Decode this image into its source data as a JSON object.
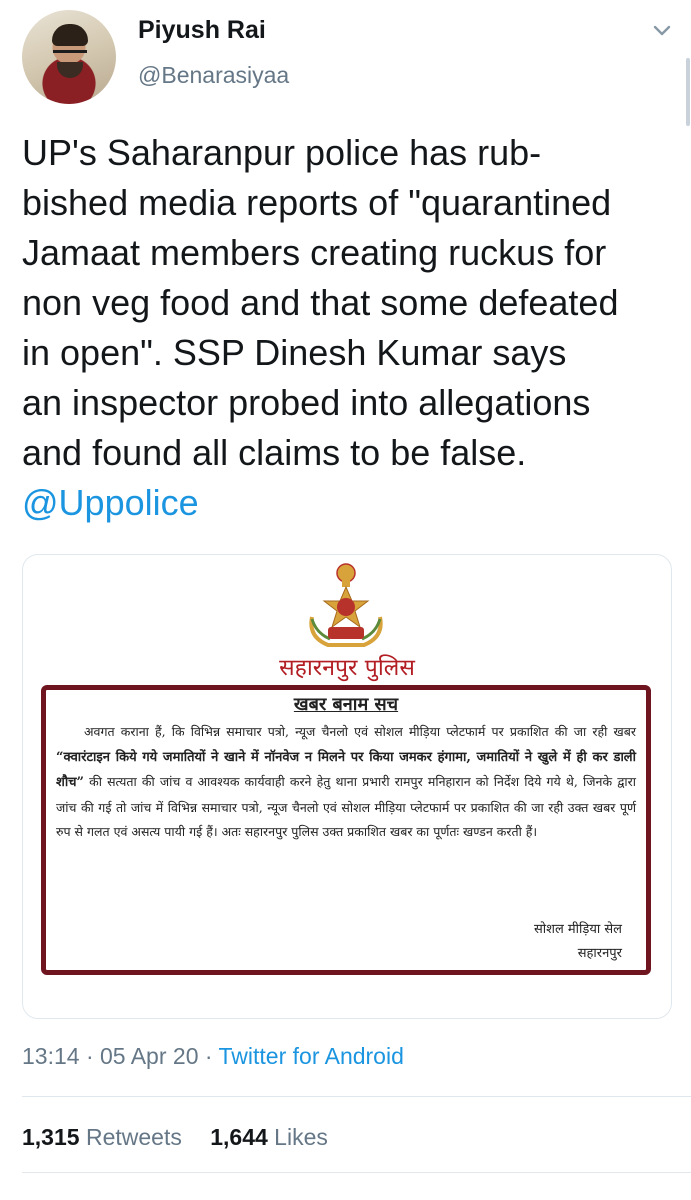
{
  "user": {
    "name": "Piyush Rai",
    "handle": "@Benarasiyaa"
  },
  "tweet": {
    "lines": [
      "UP's Saharanpur police has rub-",
      "bished media reports of \"quarantined",
      "Jamaat members creating ruckus for",
      "non veg food and that some defeated",
      "in open\". SSP Dinesh Kumar says",
      "an inspector probed into allegations",
      "and found all claims to be false."
    ],
    "mention": "@Uppolice"
  },
  "media": {
    "org_title": "सहारनपुर पुलिस",
    "notice_title": "खबर बनाम सच",
    "body_start": "अवगत कराना हैं, कि विभिन्न समाचार पत्रो, न्यूज चैनलो एवं सोशल मीड़िया प्लेटफार्म पर प्रकाशित की जा रही खबर ",
    "body_bold": "“क्वारंटाइन किये गये जमातियों ने खाने में नॉनवेज न मिलने पर किया जमकर हंगामा, जमातियों ने खुले में ही कर डाली शौच”",
    "body_end": " की सत्यता की जांच व आवश्यक कार्यवाही करने हेतु थाना प्रभारी रामपुर मनिहारान को निर्देश दिये गये थे, जिनके द्वारा जांच की गई तो जांच में विभिन्न समाचार पत्रो, न्यूज चैनलो एवं सोशल मीड़िया प्लेटफार्म पर प्रकाशित की जा रही उक्त खबर पूर्ण रुप से गलत एवं असत्य पायी गई हैं। अतः सहारनपुर पुलिस उक्त प्रकाशित खबर का पूर्णतः खण्डन करती हैं।",
    "sign_line1": "सोशल मीड़िया सेल",
    "sign_line2": "सहारनपुर"
  },
  "meta": {
    "time": "13:14",
    "sep1": " · ",
    "date": "05 Apr 20",
    "sep2": " · ",
    "source": "Twitter for Android"
  },
  "stats": {
    "retweets_count": "1,315",
    "retweets_label": "Retweets",
    "likes_count": "1,644",
    "likes_label": "Likes"
  },
  "colors": {
    "link": "#1b95e0",
    "secondary_text": "#657786",
    "notice_border": "#6e1520",
    "org_title": "#b21e24"
  },
  "icons": [
    "chevron-down-icon",
    "police-emblem"
  ]
}
